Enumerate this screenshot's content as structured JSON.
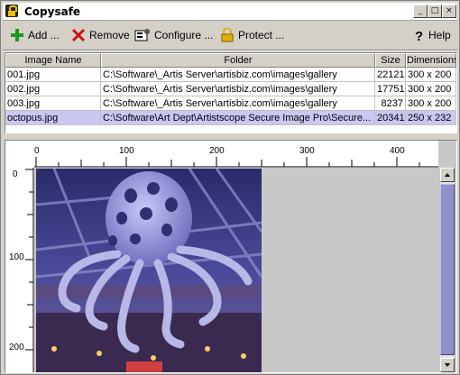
{
  "window": {
    "title": "Copysafe"
  },
  "toolbar": {
    "add_label": "Add ...",
    "remove_label": "Remove",
    "configure_label": "Configure ...",
    "protect_label": "Protect ...",
    "help_label": "Help",
    "icons": {
      "add": "plus-icon",
      "remove": "x-icon",
      "configure": "configure-icon",
      "protect": "lock-icon",
      "help": "question-icon"
    },
    "colors": {
      "add": "#1a9a1a",
      "remove": "#cc1010",
      "protect": "#e0b000"
    }
  },
  "table": {
    "columns": [
      "Image Name",
      "Folder",
      "Size",
      "Dimensions"
    ],
    "rows": [
      {
        "name": "001.jpg",
        "folder": "C:\\Software\\_Artis Server\\artisbiz.com\\images\\gallery",
        "size": "22121",
        "dims": "300 x 200"
      },
      {
        "name": "002.jpg",
        "folder": "C:\\Software\\_Artis Server\\artisbiz.com\\images\\gallery",
        "size": "17751",
        "dims": "300 x 200"
      },
      {
        "name": "003.jpg",
        "folder": "C:\\Software\\_Artis Server\\artisbiz.com\\images\\gallery",
        "size": "8237",
        "dims": "300 x 200"
      },
      {
        "name": "octopus.jpg",
        "folder": "C:\\Software\\Art Dept\\Artistscope Secure Image Pro\\Secure...",
        "size": "20341",
        "dims": "250 x 232"
      }
    ],
    "selected_row": 3
  },
  "viewer": {
    "ruler_top_labels": [
      "0",
      "100",
      "200",
      "300",
      "400"
    ],
    "ruler_left_labels": [
      "0",
      "100",
      "200"
    ],
    "accent": "#9090c8"
  }
}
